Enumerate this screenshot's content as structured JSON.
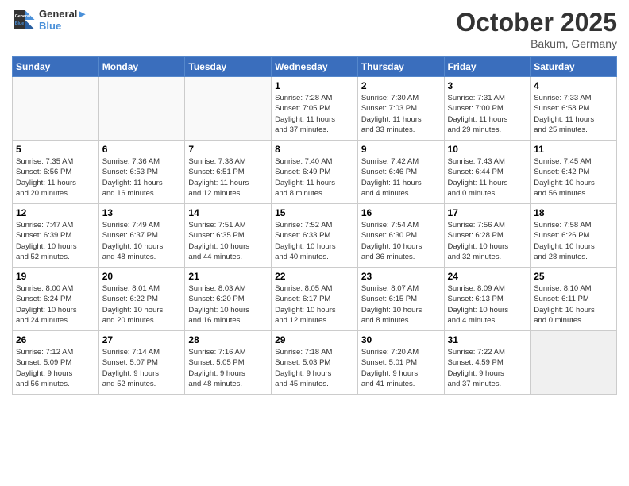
{
  "header": {
    "logo_line1": "General",
    "logo_line2": "Blue",
    "month": "October 2025",
    "location": "Bakum, Germany"
  },
  "weekdays": [
    "Sunday",
    "Monday",
    "Tuesday",
    "Wednesday",
    "Thursday",
    "Friday",
    "Saturday"
  ],
  "weeks": [
    [
      {
        "day": "",
        "info": ""
      },
      {
        "day": "",
        "info": ""
      },
      {
        "day": "",
        "info": ""
      },
      {
        "day": "1",
        "info": "Sunrise: 7:28 AM\nSunset: 7:05 PM\nDaylight: 11 hours\nand 37 minutes."
      },
      {
        "day": "2",
        "info": "Sunrise: 7:30 AM\nSunset: 7:03 PM\nDaylight: 11 hours\nand 33 minutes."
      },
      {
        "day": "3",
        "info": "Sunrise: 7:31 AM\nSunset: 7:00 PM\nDaylight: 11 hours\nand 29 minutes."
      },
      {
        "day": "4",
        "info": "Sunrise: 7:33 AM\nSunset: 6:58 PM\nDaylight: 11 hours\nand 25 minutes."
      }
    ],
    [
      {
        "day": "5",
        "info": "Sunrise: 7:35 AM\nSunset: 6:56 PM\nDaylight: 11 hours\nand 20 minutes."
      },
      {
        "day": "6",
        "info": "Sunrise: 7:36 AM\nSunset: 6:53 PM\nDaylight: 11 hours\nand 16 minutes."
      },
      {
        "day": "7",
        "info": "Sunrise: 7:38 AM\nSunset: 6:51 PM\nDaylight: 11 hours\nand 12 minutes."
      },
      {
        "day": "8",
        "info": "Sunrise: 7:40 AM\nSunset: 6:49 PM\nDaylight: 11 hours\nand 8 minutes."
      },
      {
        "day": "9",
        "info": "Sunrise: 7:42 AM\nSunset: 6:46 PM\nDaylight: 11 hours\nand 4 minutes."
      },
      {
        "day": "10",
        "info": "Sunrise: 7:43 AM\nSunset: 6:44 PM\nDaylight: 11 hours\nand 0 minutes."
      },
      {
        "day": "11",
        "info": "Sunrise: 7:45 AM\nSunset: 6:42 PM\nDaylight: 10 hours\nand 56 minutes."
      }
    ],
    [
      {
        "day": "12",
        "info": "Sunrise: 7:47 AM\nSunset: 6:39 PM\nDaylight: 10 hours\nand 52 minutes."
      },
      {
        "day": "13",
        "info": "Sunrise: 7:49 AM\nSunset: 6:37 PM\nDaylight: 10 hours\nand 48 minutes."
      },
      {
        "day": "14",
        "info": "Sunrise: 7:51 AM\nSunset: 6:35 PM\nDaylight: 10 hours\nand 44 minutes."
      },
      {
        "day": "15",
        "info": "Sunrise: 7:52 AM\nSunset: 6:33 PM\nDaylight: 10 hours\nand 40 minutes."
      },
      {
        "day": "16",
        "info": "Sunrise: 7:54 AM\nSunset: 6:30 PM\nDaylight: 10 hours\nand 36 minutes."
      },
      {
        "day": "17",
        "info": "Sunrise: 7:56 AM\nSunset: 6:28 PM\nDaylight: 10 hours\nand 32 minutes."
      },
      {
        "day": "18",
        "info": "Sunrise: 7:58 AM\nSunset: 6:26 PM\nDaylight: 10 hours\nand 28 minutes."
      }
    ],
    [
      {
        "day": "19",
        "info": "Sunrise: 8:00 AM\nSunset: 6:24 PM\nDaylight: 10 hours\nand 24 minutes."
      },
      {
        "day": "20",
        "info": "Sunrise: 8:01 AM\nSunset: 6:22 PM\nDaylight: 10 hours\nand 20 minutes."
      },
      {
        "day": "21",
        "info": "Sunrise: 8:03 AM\nSunset: 6:20 PM\nDaylight: 10 hours\nand 16 minutes."
      },
      {
        "day": "22",
        "info": "Sunrise: 8:05 AM\nSunset: 6:17 PM\nDaylight: 10 hours\nand 12 minutes."
      },
      {
        "day": "23",
        "info": "Sunrise: 8:07 AM\nSunset: 6:15 PM\nDaylight: 10 hours\nand 8 minutes."
      },
      {
        "day": "24",
        "info": "Sunrise: 8:09 AM\nSunset: 6:13 PM\nDaylight: 10 hours\nand 4 minutes."
      },
      {
        "day": "25",
        "info": "Sunrise: 8:10 AM\nSunset: 6:11 PM\nDaylight: 10 hours\nand 0 minutes."
      }
    ],
    [
      {
        "day": "26",
        "info": "Sunrise: 7:12 AM\nSunset: 5:09 PM\nDaylight: 9 hours\nand 56 minutes."
      },
      {
        "day": "27",
        "info": "Sunrise: 7:14 AM\nSunset: 5:07 PM\nDaylight: 9 hours\nand 52 minutes."
      },
      {
        "day": "28",
        "info": "Sunrise: 7:16 AM\nSunset: 5:05 PM\nDaylight: 9 hours\nand 48 minutes."
      },
      {
        "day": "29",
        "info": "Sunrise: 7:18 AM\nSunset: 5:03 PM\nDaylight: 9 hours\nand 45 minutes."
      },
      {
        "day": "30",
        "info": "Sunrise: 7:20 AM\nSunset: 5:01 PM\nDaylight: 9 hours\nand 41 minutes."
      },
      {
        "day": "31",
        "info": "Sunrise: 7:22 AM\nSunset: 4:59 PM\nDaylight: 9 hours\nand 37 minutes."
      },
      {
        "day": "",
        "info": ""
      }
    ]
  ]
}
